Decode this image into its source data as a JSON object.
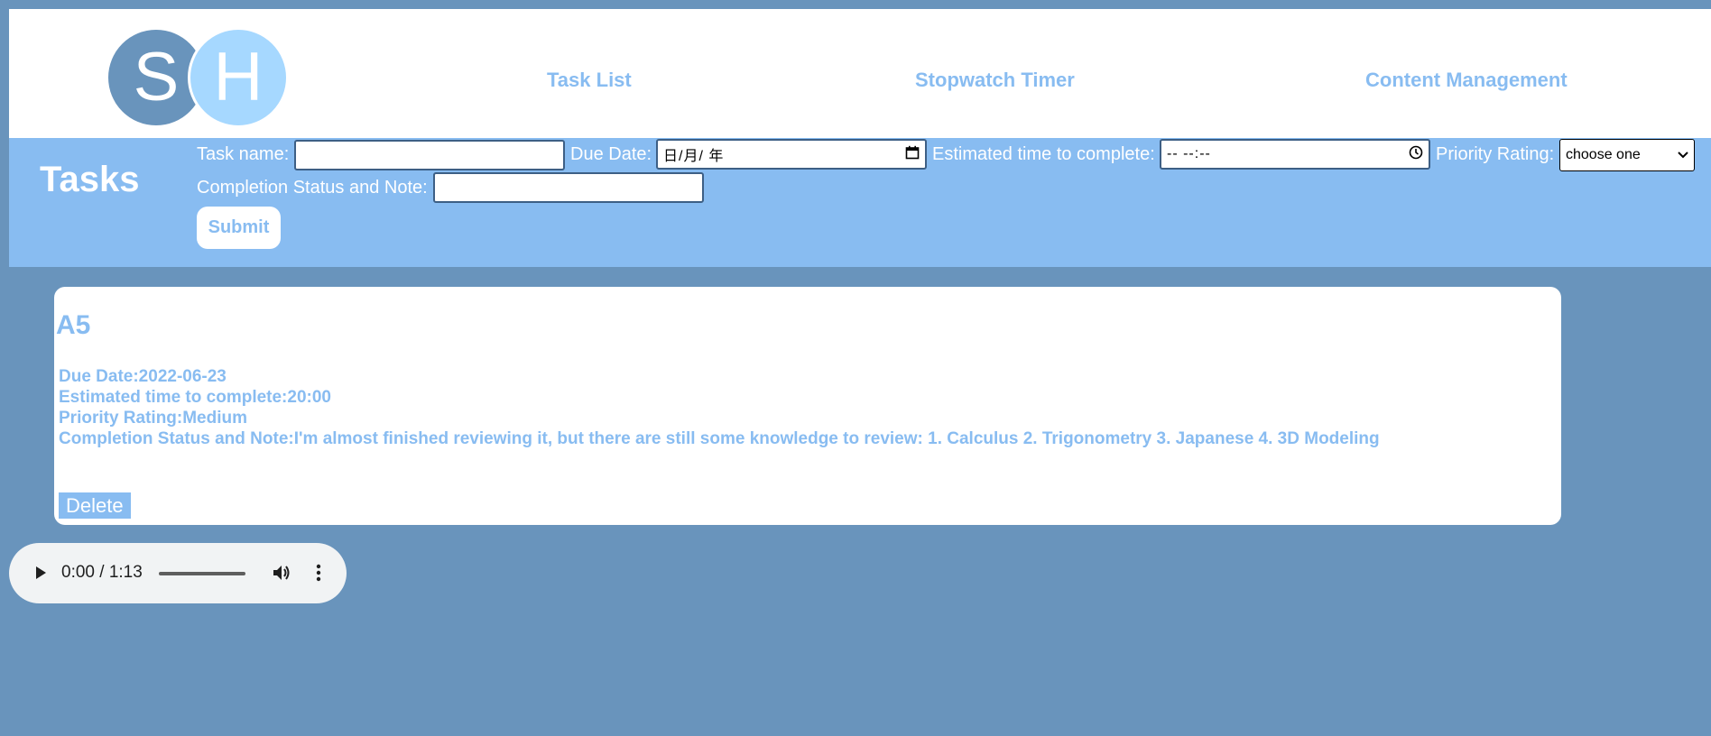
{
  "header": {
    "logo_left": "S",
    "logo_right": "H",
    "nav": [
      "Task List",
      "Stopwatch Timer",
      "Content Management"
    ]
  },
  "form": {
    "title": "Tasks",
    "task_name_label": "Task name:",
    "task_name_value": "",
    "due_date_label": "Due Date:",
    "due_date_placeholder": "日/月/ 年",
    "est_time_label": "Estimated time to complete:",
    "est_time_placeholder": "-- --:--",
    "priority_label": "Priority Rating:",
    "priority_selected": "choose one",
    "status_label": "Completion Status and Note:",
    "status_value": "",
    "submit_label": "Submit"
  },
  "task": {
    "name": "A5",
    "due_date": "Due Date:2022-06-23",
    "est_time": "Estimated time to complete:20:00",
    "priority": "Priority Rating:Medium",
    "status": "Completion Status and Note:I'm almost finished reviewing it, but there are still some knowledge to review: 1. Calculus 2. Trigonometry 3. Japanese 4. 3D Modeling",
    "delete_label": "Delete"
  },
  "audio": {
    "time": "0:00 / 1:13",
    "progress": 0
  },
  "colors": {
    "background": "#6994bc",
    "accent": "#88bcf1",
    "logo_light": "#a6d8ff"
  }
}
